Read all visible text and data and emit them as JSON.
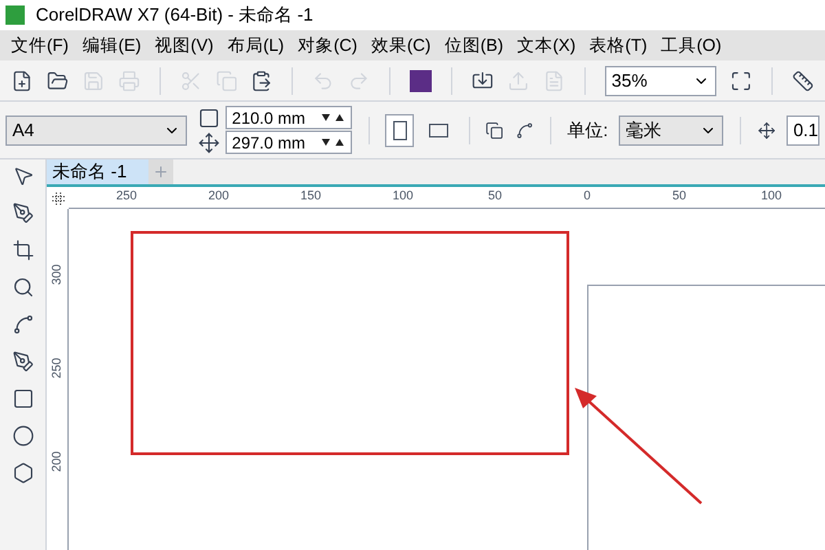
{
  "window": {
    "title": "CorelDRAW X7 (64-Bit) - 未命名 -1"
  },
  "menu": [
    "文件(F)",
    "编辑(E)",
    "视图(V)",
    "布局(L)",
    "对象(C)",
    "效果(C)",
    "位图(B)",
    "文本(X)",
    "表格(T)",
    "工具(O)"
  ],
  "toolbar": {
    "zoom": "35%"
  },
  "property_bar": {
    "page_size": "A4",
    "width": "210.0 mm",
    "height": "297.0 mm",
    "orientation_portrait": {
      "selected": true
    },
    "unit_label": "单位:",
    "unit": "毫米",
    "nudge": "0.1"
  },
  "tabs": [
    {
      "label": "未命名 -1",
      "selected": true
    }
  ],
  "ruler_horizontal": [
    "250",
    "200",
    "150",
    "100",
    "50",
    "0",
    "50",
    "100"
  ],
  "ruler_vertical": [
    "300",
    "250",
    "200"
  ]
}
